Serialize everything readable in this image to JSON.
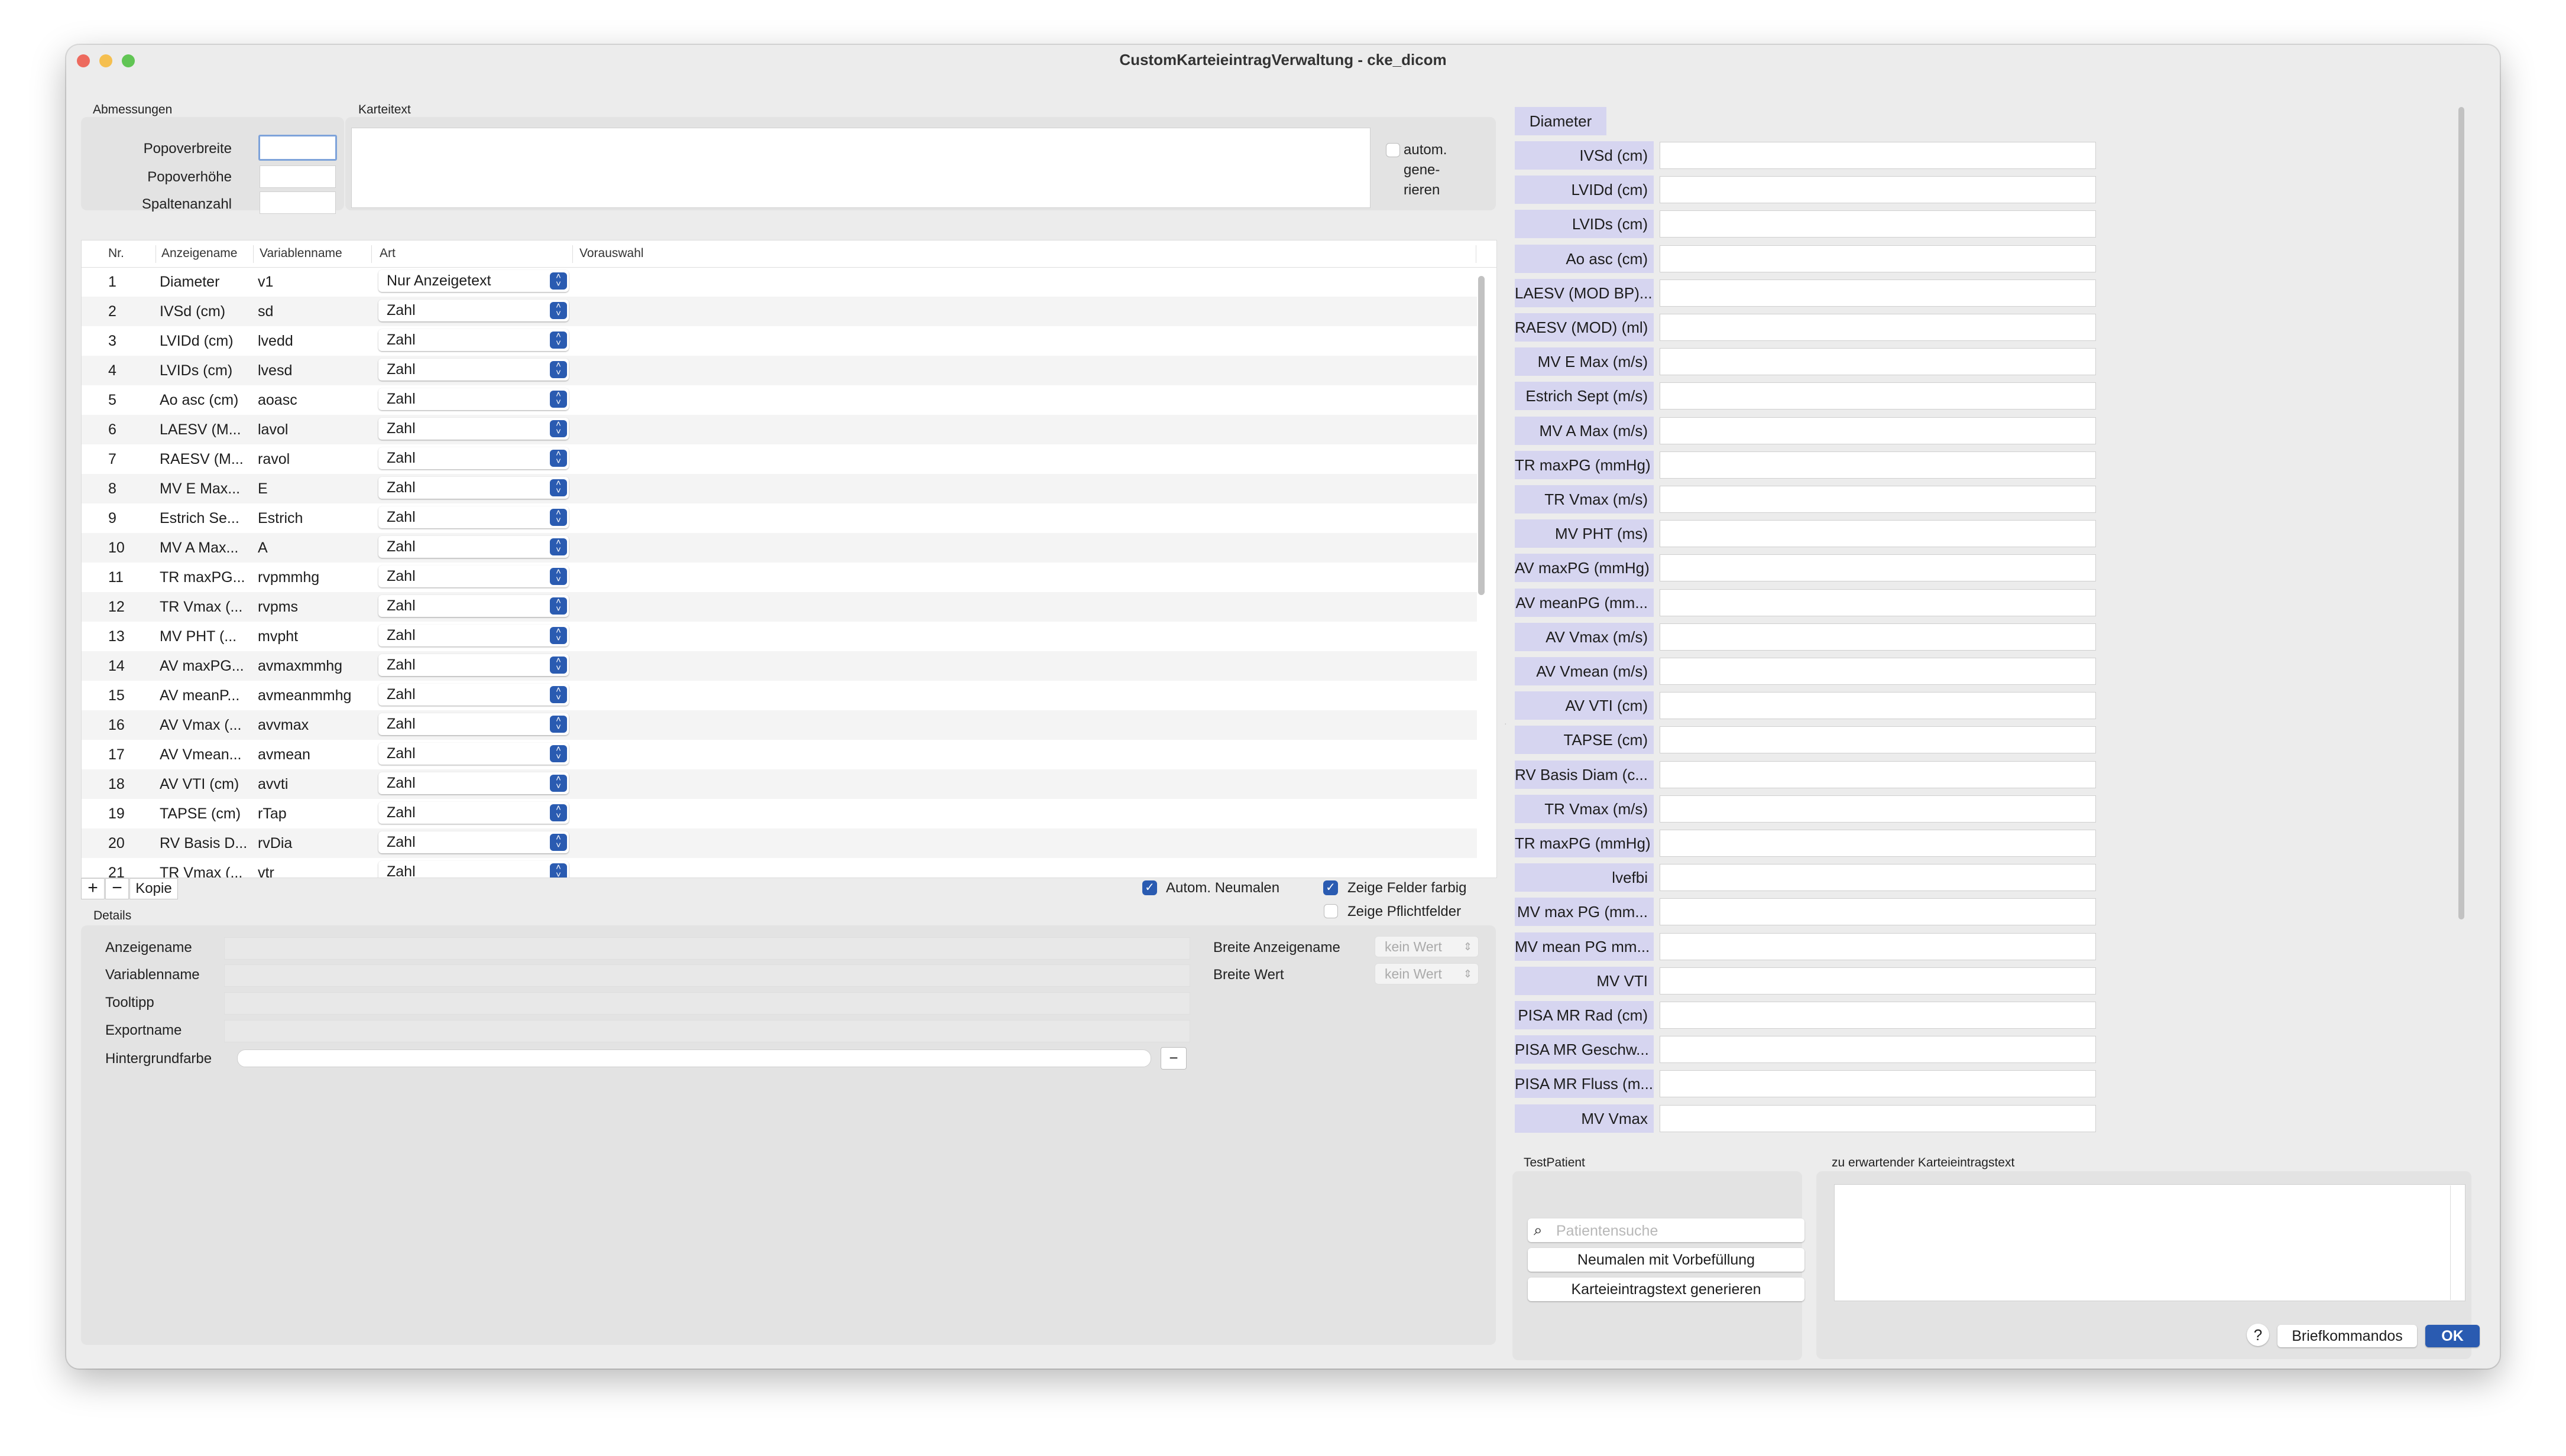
{
  "window": {
    "title": "CustomKarteieintragVerwaltung - cke_dicom"
  },
  "abmessungen": {
    "title": "Abmessungen",
    "labels": [
      "Popoverbreite",
      "Popoverhöhe",
      "Spaltenanzahl"
    ]
  },
  "karteitext": {
    "title": "Karteitext",
    "autom_label": [
      "autom.",
      "gene-",
      "rieren"
    ],
    "autom_checked": false
  },
  "table": {
    "headers": [
      "Nr.",
      "Anzeigename",
      "Variablenname",
      "Art",
      "Vorauswahl"
    ],
    "rows": [
      [
        "1",
        "Diameter",
        "v1",
        "Nur Anzeigetext"
      ],
      [
        "2",
        "IVSd (cm)",
        "sd",
        "Zahl"
      ],
      [
        "3",
        "LVIDd (cm)",
        "lvedd",
        "Zahl"
      ],
      [
        "4",
        "LVIDs (cm)",
        "lvesd",
        "Zahl"
      ],
      [
        "5",
        "Ao asc (cm)",
        "aoasc",
        "Zahl"
      ],
      [
        "6",
        "LAESV (M...",
        "lavol",
        "Zahl"
      ],
      [
        "7",
        "RAESV (M...",
        "ravol",
        "Zahl"
      ],
      [
        "8",
        "MV E Max...",
        "E",
        "Zahl"
      ],
      [
        "9",
        "Estrich Se...",
        "Estrich",
        "Zahl"
      ],
      [
        "10",
        "MV A Max...",
        "A",
        "Zahl"
      ],
      [
        "11",
        "TR maxPG...",
        "rvpmmhg",
        "Zahl"
      ],
      [
        "12",
        "TR Vmax (...",
        "rvpms",
        "Zahl"
      ],
      [
        "13",
        "MV PHT (...",
        "mvpht",
        "Zahl"
      ],
      [
        "14",
        "AV maxPG...",
        "avmaxmmhg",
        "Zahl"
      ],
      [
        "15",
        "AV meanP...",
        "avmeanmmhg",
        "Zahl"
      ],
      [
        "16",
        "AV Vmax (...",
        "avvmax",
        "Zahl"
      ],
      [
        "17",
        "AV Vmean...",
        "avmean",
        "Zahl"
      ],
      [
        "18",
        "AV VTI (cm)",
        "avvti",
        "Zahl"
      ],
      [
        "19",
        "TAPSE (cm)",
        "rTap",
        "Zahl"
      ],
      [
        "20",
        "RV Basis D...",
        "rvDia",
        "Zahl"
      ],
      [
        "21",
        "TR Vmax (...",
        "vtr",
        "Zahl"
      ]
    ],
    "add_label": "+",
    "remove_label": "−",
    "copy_label": "Kopie"
  },
  "options": {
    "autom_neumalen": {
      "label": "Autom. Neumalen",
      "checked": true
    },
    "zeige_farbig": {
      "label": "Zeige Felder farbig",
      "checked": true
    },
    "zeige_pflicht": {
      "label": "Zeige Pflichtfelder",
      "checked": false
    }
  },
  "details": {
    "title": "Details",
    "labels": [
      "Anzeigename",
      "Variablenname",
      "Tooltipp",
      "Exportname",
      "Hintergrundfarbe"
    ],
    "breite_anzeigename": "Breite Anzeigename",
    "breite_wert": "Breite Wert",
    "kein_wert": "kein Wert",
    "color_clear": "−"
  },
  "preview": {
    "header": "Diameter",
    "fields": [
      "IVSd (cm)",
      "LVIDd (cm)",
      "LVIDs (cm)",
      "Ao asc (cm)",
      "LAESV (MOD BP)...",
      "RAESV (MOD) (ml)",
      "MV E Max (m/s)",
      "Estrich Sept (m/s)",
      "MV A Max (m/s)",
      "TR maxPG (mmHg)",
      "TR Vmax (m/s)",
      "MV PHT (ms)",
      "AV maxPG (mmHg)",
      "AV meanPG (mm...",
      "AV Vmax (m/s)",
      "AV Vmean (m/s)",
      "AV VTI (cm)",
      "TAPSE (cm)",
      "RV Basis Diam (c...",
      "TR Vmax (m/s)",
      "TR maxPG (mmHg)",
      "lvefbi",
      "MV max PG (mm...",
      "MV mean PG mm...",
      "MV VTI",
      "PISA MR Rad (cm)",
      "PISA MR Geschw...",
      "PISA MR Fluss (m...",
      "MV Vmax"
    ],
    "label_color": "#d6d5f0"
  },
  "testpatient": {
    "title": "TestPatient",
    "search_placeholder": "Patientensuche",
    "btn_neumalen": "Neumalen mit Vorbefüllung",
    "btn_generieren": "Karteieintragstext generieren"
  },
  "expected": {
    "title": "zu erwartender Karteieintragstext"
  },
  "footer": {
    "help": "?",
    "briefkommandos": "Briefkommandos",
    "ok": "OK"
  },
  "colors": {
    "accent": "#2a5bb1",
    "close": "#ed6a5e",
    "minimize": "#f5bf4f",
    "maximize": "#61c554"
  }
}
